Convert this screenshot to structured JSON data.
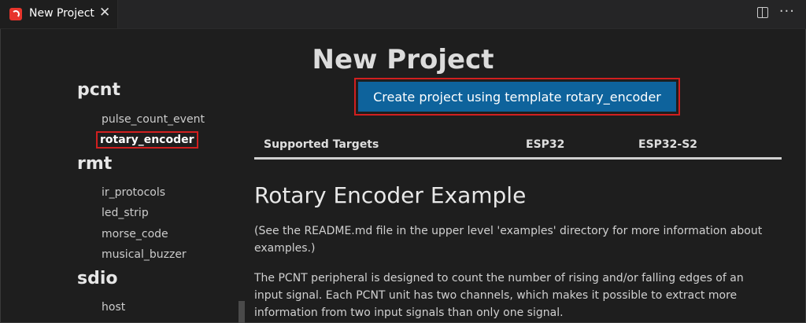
{
  "tab": {
    "title": "New Project",
    "close": "✕",
    "logo_icon": "espressif-logo-icon"
  },
  "actions": {
    "split_icon": "split-editor-icon",
    "more_icon": "more-actions-icon",
    "more_glyph": "···"
  },
  "sidebar": {
    "categories": [
      {
        "label": "pcnt",
        "items": [
          "pulse_count_event",
          "rotary_encoder"
        ]
      },
      {
        "label": "rmt",
        "items": [
          "ir_protocols",
          "led_strip",
          "morse_code",
          "musical_buzzer"
        ]
      },
      {
        "label": "sdio",
        "items": [
          "host"
        ]
      }
    ],
    "selected": "rotary_encoder"
  },
  "main": {
    "page_title": "New Project",
    "create_button": "Create project using template rotary_encoder",
    "targets": {
      "header": "Supported Targets",
      "t1": "ESP32",
      "t2": "ESP32-S2"
    },
    "heading": "Rotary Encoder Example",
    "para1": "(See the README.md file in the upper level 'examples' directory for more information about examples.)",
    "para2": "The PCNT peripheral is designed to count the number of rising and/or falling edges of an input signal. Each PCNT unit has two channels, which makes it possible to extract more information from two input signals than only one signal."
  },
  "colors": {
    "accent": "#0e639c",
    "highlight": "#d11f1f",
    "background": "#1e1e1e"
  }
}
